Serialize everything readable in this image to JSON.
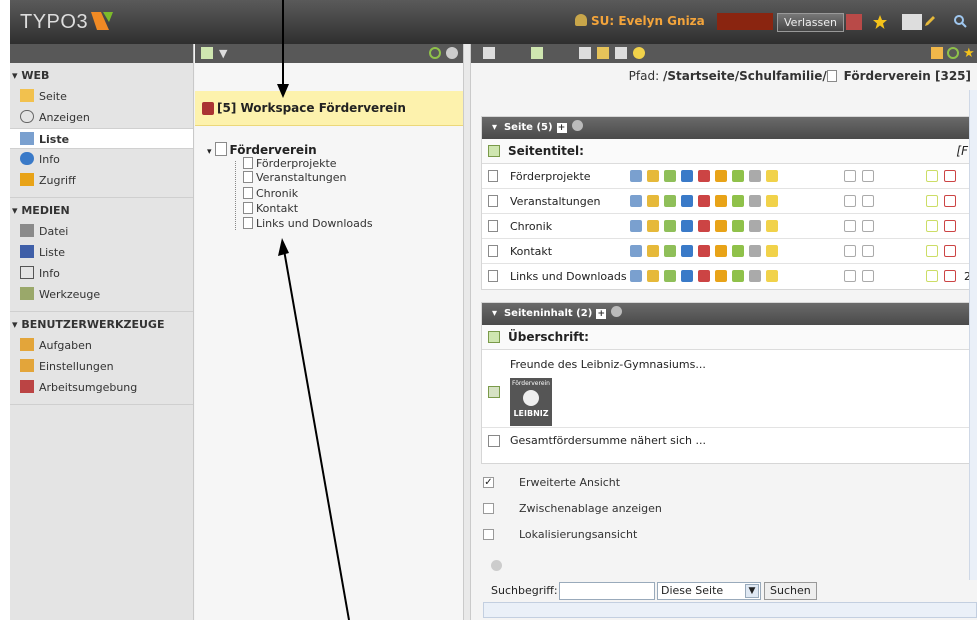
{
  "header": {
    "logo": "TYPO3",
    "su_label": "SU: Evelyn Gniza",
    "leave_button": "Verlassen"
  },
  "modules": {
    "web": {
      "title": "WEB",
      "items": [
        {
          "label": "Seite",
          "icon": "page-edit-icon"
        },
        {
          "label": "Anzeigen",
          "icon": "eye-icon"
        },
        {
          "label": "Liste",
          "icon": "list-icon",
          "active": true
        },
        {
          "label": "Info",
          "icon": "info-icon"
        },
        {
          "label": "Zugriff",
          "icon": "lock-icon"
        }
      ]
    },
    "medien": {
      "title": "MEDIEN",
      "items": [
        {
          "label": "Datei",
          "icon": "folder-icon"
        },
        {
          "label": "Liste",
          "icon": "list-icon"
        },
        {
          "label": "Info",
          "icon": "info-icon"
        },
        {
          "label": "Werkzeuge",
          "icon": "tools-icon"
        }
      ]
    },
    "tools": {
      "title": "BENUTZERWERKZEUGE",
      "items": [
        {
          "label": "Aufgaben",
          "icon": "tasks-icon"
        },
        {
          "label": "Einstellungen",
          "icon": "settings-icon"
        },
        {
          "label": "Arbeitsumgebung",
          "icon": "workspace-icon"
        }
      ]
    }
  },
  "tree": {
    "workspace": "[5] Workspace Förderverein",
    "root": "Förderverein",
    "children": [
      "Förderprojekte",
      "Veranstaltungen",
      "Chronik",
      "Kontakt",
      "Links und Downloads"
    ]
  },
  "content": {
    "path_label": "Pfad:",
    "path_value": "/Startseite/Schulfamilie/",
    "path_page": "Förderverein [325]",
    "pages_panel": {
      "title": "Seite (5)",
      "column": "Seitentitel:",
      "col_truncated": "[F",
      "rows": [
        "Förderprojekte",
        "Veranstaltungen",
        "Chronik",
        "Kontakt",
        "Links und Downloads"
      ],
      "last_row_extra": "2"
    },
    "content_panel": {
      "title": "Seiteninhalt (2)",
      "column": "Überschrift:",
      "rows": [
        "Freunde des Leibniz-Gymnasiums...",
        "Gesamtfördersumme nähert sich ..."
      ],
      "thumb_text_top": "Förderverein",
      "thumb_text_bottom": "LEIBNIZ"
    },
    "options": [
      {
        "label": "Erweiterte Ansicht",
        "checked": true
      },
      {
        "label": "Zwischenablage anzeigen",
        "checked": false
      },
      {
        "label": "Lokalisierungsansicht",
        "checked": false
      }
    ],
    "search": {
      "label": "Suchbegriff:",
      "value": "",
      "scope": "Diese Seite",
      "button": "Suchen"
    }
  }
}
